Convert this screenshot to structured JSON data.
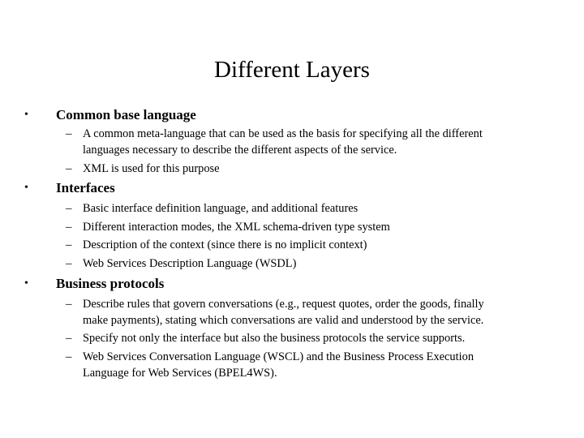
{
  "slide": {
    "title": "Different Layers",
    "bullet_glyph": "•",
    "dash_glyph": "–",
    "sections": [
      {
        "heading": "Common base language",
        "items": [
          {
            "lines": [
              "A common meta-language that can be used as the basis for specifying all the different",
              "languages necessary to describe the different aspects of the service."
            ]
          },
          {
            "lines": [
              "XML is used for this purpose"
            ]
          }
        ]
      },
      {
        "heading": "Interfaces",
        "items": [
          {
            "lines": [
              "Basic interface definition language, and additional features"
            ]
          },
          {
            "lines": [
              "Different interaction modes, the XML schema-driven type system"
            ]
          },
          {
            "lines": [
              "Description of the context (since there is no implicit context)"
            ]
          },
          {
            "lines": [
              "Web Services Description Language (WSDL)"
            ]
          }
        ]
      },
      {
        "heading": "Business protocols",
        "items": [
          {
            "lines": [
              "Describe rules that govern conversations (e.g., request quotes, order the goods, finally",
              "make payments), stating which conversations are valid and understood by the service."
            ]
          },
          {
            "lines": [
              "Specify not only the interface but also the business protocols the service supports."
            ]
          },
          {
            "lines": [
              "Web Services Conversation Language (WSCL) and the Business Process Execution",
              "Language for Web Services (BPEL4WS)."
            ]
          }
        ]
      }
    ]
  }
}
